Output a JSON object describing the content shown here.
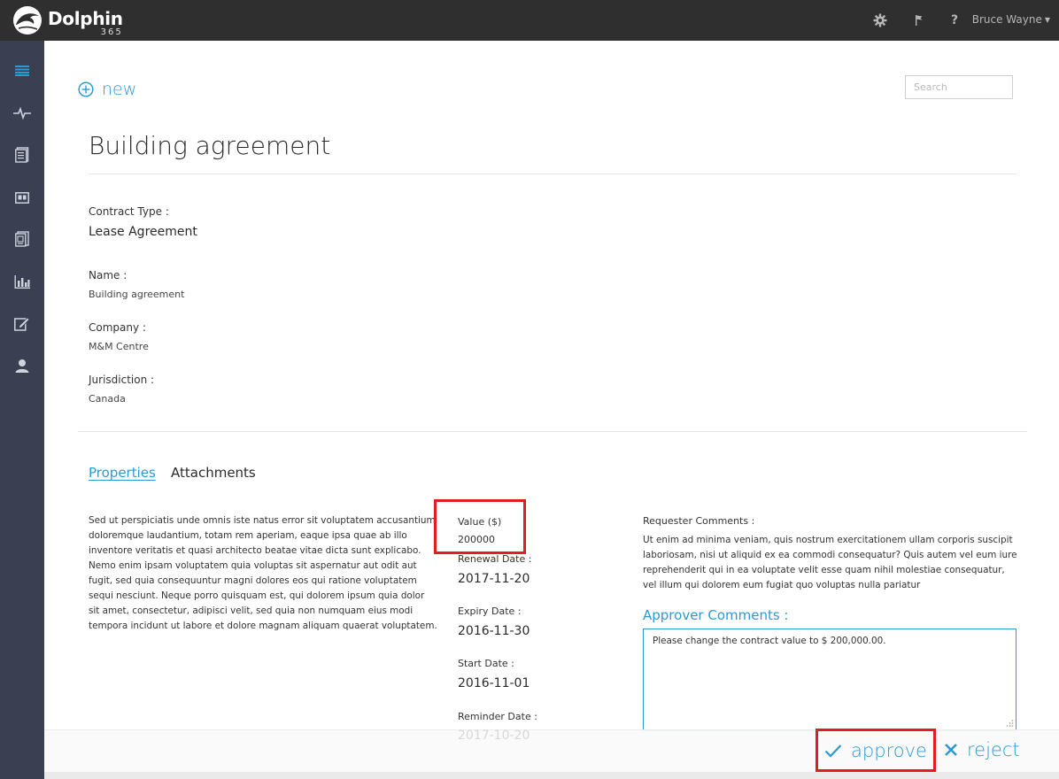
{
  "header": {
    "logo_text": "Dolphin",
    "logo_sub": "365",
    "help_label": "?",
    "user_name": "Bruce Wayne",
    "user_caret": "▼"
  },
  "toolbar": {
    "new_label": "new",
    "search_placeholder": "Search"
  },
  "contract": {
    "title": "Building agreement",
    "type_label": "Contract Type :",
    "type_value": "Lease Agreement",
    "name_label": "Name :",
    "name_value": "Building agreement",
    "company_label": "Company :",
    "company_value": "M&M Centre",
    "jurisdiction_label": "Jurisdiction :",
    "jurisdiction_value": "Canada"
  },
  "tabs": [
    {
      "label": "Properties",
      "active": true
    },
    {
      "label": "Attachments",
      "active": false
    }
  ],
  "properties": {
    "description": "Sed ut perspiciatis unde omnis iste natus error sit voluptatem accusantium doloremque laudantium, totam rem aperiam, eaque ipsa quae ab illo inventore veritatis et quasi architecto beatae vitae dicta sunt explicabo. Nemo enim ipsam voluptatem quia voluptas sit aspernatur aut odit aut fugit, sed quia consequuntur magni dolores eos qui ratione voluptatem sequi nesciunt. Neque porro quisquam est, qui dolorem ipsum quia dolor sit amet, consectetur, adipisci velit, sed quia non numquam eius modi tempora incidunt ut labore et dolore magnam aliquam quaerat voluptatem.",
    "value_label": "Value ($)",
    "value": "200000",
    "renewal_label": "Renewal Date :",
    "renewal_date": "2017-11-20",
    "expiry_label": "Expiry Date :",
    "expiry_date": "2016-11-30",
    "start_label": "Start Date :",
    "start_date": "2016-11-01",
    "reminder_label": "Reminder Date :",
    "reminder_date": "2017-10-20"
  },
  "comments": {
    "requester_label": "Requester Comments :",
    "requester_text": "Ut enim ad minima veniam, quis nostrum exercitationem ullam corporis suscipit laboriosam, nisi ut aliquid ex ea commodi consequatur? Quis autem vel eum iure reprehenderit qui in ea voluptate velit esse quam nihil molestiae consequatur, vel illum qui dolorem eum fugiat quo voluptas nulla pariatur",
    "approver_label": "Approver Comments :",
    "approver_text": "Please change the contract value to $ 200,000.00."
  },
  "actions": {
    "approve_label": "approve",
    "reject_label": "reject"
  },
  "colors": {
    "accent": "#2b9ad5",
    "topbar": "#2f2f2f",
    "sidebar": "#3a3f52",
    "highlight": "#e31b23"
  },
  "sidebar_icons": [
    "menu-icon",
    "activity-icon",
    "documents-icon",
    "contracts-icon",
    "files-icon",
    "reports-icon",
    "edit-icon",
    "user-icon"
  ]
}
